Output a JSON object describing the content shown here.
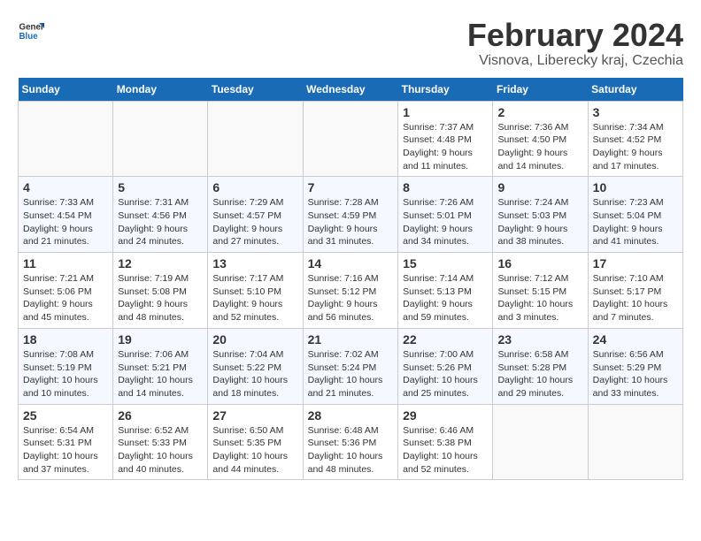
{
  "logo": {
    "text_general": "General",
    "text_blue": "Blue"
  },
  "title": {
    "month_year": "February 2024",
    "location": "Visnova, Liberecky kraj, Czechia"
  },
  "days_of_week": [
    "Sunday",
    "Monday",
    "Tuesday",
    "Wednesday",
    "Thursday",
    "Friday",
    "Saturday"
  ],
  "weeks": [
    [
      {
        "day": "",
        "info": ""
      },
      {
        "day": "",
        "info": ""
      },
      {
        "day": "",
        "info": ""
      },
      {
        "day": "",
        "info": ""
      },
      {
        "day": "1",
        "info": "Sunrise: 7:37 AM\nSunset: 4:48 PM\nDaylight: 9 hours\nand 11 minutes."
      },
      {
        "day": "2",
        "info": "Sunrise: 7:36 AM\nSunset: 4:50 PM\nDaylight: 9 hours\nand 14 minutes."
      },
      {
        "day": "3",
        "info": "Sunrise: 7:34 AM\nSunset: 4:52 PM\nDaylight: 9 hours\nand 17 minutes."
      }
    ],
    [
      {
        "day": "4",
        "info": "Sunrise: 7:33 AM\nSunset: 4:54 PM\nDaylight: 9 hours\nand 21 minutes."
      },
      {
        "day": "5",
        "info": "Sunrise: 7:31 AM\nSunset: 4:56 PM\nDaylight: 9 hours\nand 24 minutes."
      },
      {
        "day": "6",
        "info": "Sunrise: 7:29 AM\nSunset: 4:57 PM\nDaylight: 9 hours\nand 27 minutes."
      },
      {
        "day": "7",
        "info": "Sunrise: 7:28 AM\nSunset: 4:59 PM\nDaylight: 9 hours\nand 31 minutes."
      },
      {
        "day": "8",
        "info": "Sunrise: 7:26 AM\nSunset: 5:01 PM\nDaylight: 9 hours\nand 34 minutes."
      },
      {
        "day": "9",
        "info": "Sunrise: 7:24 AM\nSunset: 5:03 PM\nDaylight: 9 hours\nand 38 minutes."
      },
      {
        "day": "10",
        "info": "Sunrise: 7:23 AM\nSunset: 5:04 PM\nDaylight: 9 hours\nand 41 minutes."
      }
    ],
    [
      {
        "day": "11",
        "info": "Sunrise: 7:21 AM\nSunset: 5:06 PM\nDaylight: 9 hours\nand 45 minutes."
      },
      {
        "day": "12",
        "info": "Sunrise: 7:19 AM\nSunset: 5:08 PM\nDaylight: 9 hours\nand 48 minutes."
      },
      {
        "day": "13",
        "info": "Sunrise: 7:17 AM\nSunset: 5:10 PM\nDaylight: 9 hours\nand 52 minutes."
      },
      {
        "day": "14",
        "info": "Sunrise: 7:16 AM\nSunset: 5:12 PM\nDaylight: 9 hours\nand 56 minutes."
      },
      {
        "day": "15",
        "info": "Sunrise: 7:14 AM\nSunset: 5:13 PM\nDaylight: 9 hours\nand 59 minutes."
      },
      {
        "day": "16",
        "info": "Sunrise: 7:12 AM\nSunset: 5:15 PM\nDaylight: 10 hours\nand 3 minutes."
      },
      {
        "day": "17",
        "info": "Sunrise: 7:10 AM\nSunset: 5:17 PM\nDaylight: 10 hours\nand 7 minutes."
      }
    ],
    [
      {
        "day": "18",
        "info": "Sunrise: 7:08 AM\nSunset: 5:19 PM\nDaylight: 10 hours\nand 10 minutes."
      },
      {
        "day": "19",
        "info": "Sunrise: 7:06 AM\nSunset: 5:21 PM\nDaylight: 10 hours\nand 14 minutes."
      },
      {
        "day": "20",
        "info": "Sunrise: 7:04 AM\nSunset: 5:22 PM\nDaylight: 10 hours\nand 18 minutes."
      },
      {
        "day": "21",
        "info": "Sunrise: 7:02 AM\nSunset: 5:24 PM\nDaylight: 10 hours\nand 21 minutes."
      },
      {
        "day": "22",
        "info": "Sunrise: 7:00 AM\nSunset: 5:26 PM\nDaylight: 10 hours\nand 25 minutes."
      },
      {
        "day": "23",
        "info": "Sunrise: 6:58 AM\nSunset: 5:28 PM\nDaylight: 10 hours\nand 29 minutes."
      },
      {
        "day": "24",
        "info": "Sunrise: 6:56 AM\nSunset: 5:29 PM\nDaylight: 10 hours\nand 33 minutes."
      }
    ],
    [
      {
        "day": "25",
        "info": "Sunrise: 6:54 AM\nSunset: 5:31 PM\nDaylight: 10 hours\nand 37 minutes."
      },
      {
        "day": "26",
        "info": "Sunrise: 6:52 AM\nSunset: 5:33 PM\nDaylight: 10 hours\nand 40 minutes."
      },
      {
        "day": "27",
        "info": "Sunrise: 6:50 AM\nSunset: 5:35 PM\nDaylight: 10 hours\nand 44 minutes."
      },
      {
        "day": "28",
        "info": "Sunrise: 6:48 AM\nSunset: 5:36 PM\nDaylight: 10 hours\nand 48 minutes."
      },
      {
        "day": "29",
        "info": "Sunrise: 6:46 AM\nSunset: 5:38 PM\nDaylight: 10 hours\nand 52 minutes."
      },
      {
        "day": "",
        "info": ""
      },
      {
        "day": "",
        "info": ""
      }
    ]
  ]
}
